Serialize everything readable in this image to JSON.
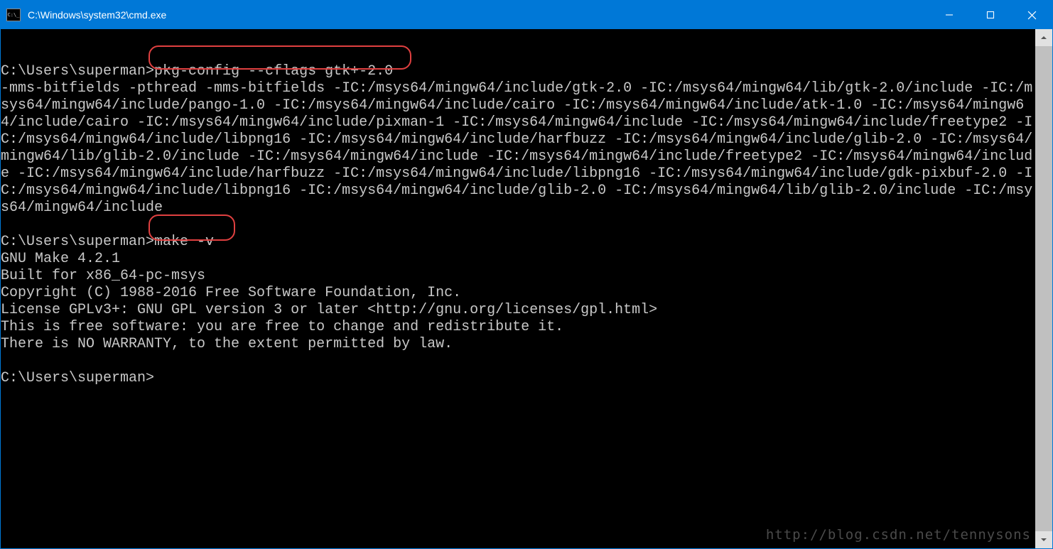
{
  "title": "C:\\Windows\\system32\\cmd.exe",
  "terminal": {
    "prompt1": "C:\\Users\\superman>",
    "cmd1": "pkg-config --cflags gtk+-2.0",
    "out1": "-mms-bitfields -pthread -mms-bitfields -IC:/msys64/mingw64/include/gtk-2.0 -IC:/msys64/mingw64/lib/gtk-2.0/include -IC:/msys64/mingw64/include/pango-1.0 -IC:/msys64/mingw64/include/cairo -IC:/msys64/mingw64/include/atk-1.0 -IC:/msys64/mingw64/include/cairo -IC:/msys64/mingw64/include/pixman-1 -IC:/msys64/mingw64/include -IC:/msys64/mingw64/include/freetype2 -IC:/msys64/mingw64/include/libpng16 -IC:/msys64/mingw64/include/harfbuzz -IC:/msys64/mingw64/include/glib-2.0 -IC:/msys64/mingw64/lib/glib-2.0/include -IC:/msys64/mingw64/include -IC:/msys64/mingw64/include/freetype2 -IC:/msys64/mingw64/include -IC:/msys64/mingw64/include/harfbuzz -IC:/msys64/mingw64/include/libpng16 -IC:/msys64/mingw64/include/gdk-pixbuf-2.0 -IC:/msys64/mingw64/include/libpng16 -IC:/msys64/mingw64/include/glib-2.0 -IC:/msys64/mingw64/lib/glib-2.0/include -IC:/msys64/mingw64/include",
    "prompt2": "C:\\Users\\superman>",
    "cmd2": "make -v",
    "out2l1": "GNU Make 4.2.1",
    "out2l2": "Built for x86_64-pc-msys",
    "out2l3": "Copyright (C) 1988-2016 Free Software Foundation, Inc.",
    "out2l4": "License GPLv3+: GNU GPL version 3 or later <http://gnu.org/licenses/gpl.html>",
    "out2l5": "This is free software: you are free to change and redistribute it.",
    "out2l6": "There is NO WARRANTY, to the extent permitted by law.",
    "prompt3": "C:\\Users\\superman>"
  },
  "watermark": "http://blog.csdn.net/tennysons"
}
